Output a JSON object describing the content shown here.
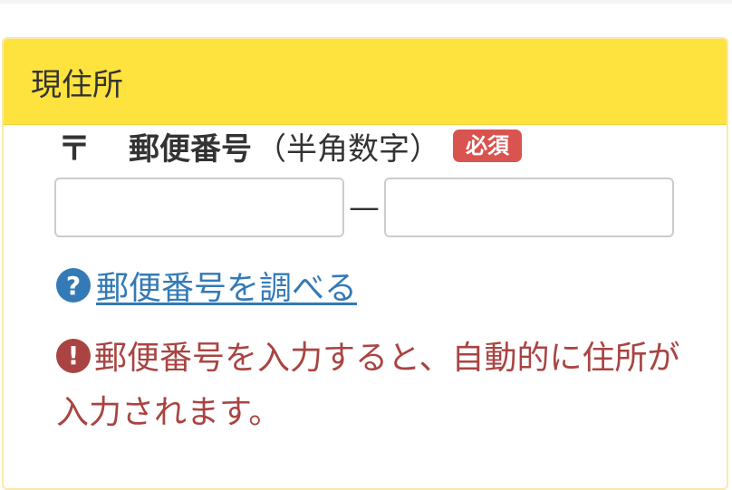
{
  "panel": {
    "title": "現住所"
  },
  "postal": {
    "mark": "〒",
    "label": "郵便番号",
    "sublabel": "（半角数字）",
    "required_badge": "必須",
    "first_value": "",
    "second_value": "",
    "separator": "—"
  },
  "help": {
    "icon": "question-circle-icon",
    "link_text": "郵便番号を調べる"
  },
  "notice": {
    "icon": "exclamation-circle-icon",
    "text": "郵便番号を入力すると、自動的に住所が入力されます。"
  },
  "colors": {
    "header_bg": "#fee23e",
    "badge": "#d9534f",
    "link": "#337ab7",
    "notice": "#a94442"
  }
}
